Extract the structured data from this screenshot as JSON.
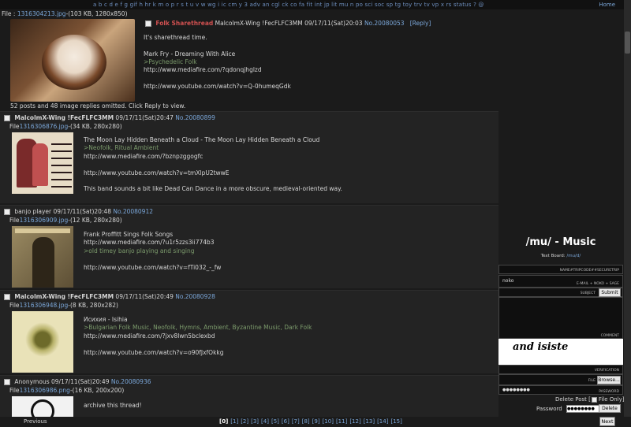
{
  "nav": {
    "boards": "a  b  c  d  e  f  g  gif  h  hr  k  m  o  p  r  s  t  u  v  w  wg  i  ic  cm  y  3  adv  an  cgl  ck  co  fa  fit  int  jp  lit  mu  n  po  sci  soc  sp  tg  toy  trv  tv  vp  x  rs  status  ?  @",
    "home": "Home"
  },
  "op": {
    "file_label": "File : ",
    "file_name": "1316304213.jpg",
    "file_meta": "-(103 KB, 1280x850)",
    "subject": "Folk Sharethread",
    "name": "MalcolmX-Wing !FecFLFC3MM",
    "date": "09/17/11(Sat)20:03",
    "no": "No.20080053",
    "reply_link": "[Reply]",
    "lines": [
      "It's sharethread time.",
      "",
      "Mark Fry - Dreaming With Alice",
      ">Psychedelic Folk",
      "http://www.mediafire.com/?qdonqjhglzd",
      "",
      "http://www.youtube.com/watch?v=Q-0humeqGdk"
    ],
    "omitted": "52 posts and 48 image replies omitted. Click Reply to view."
  },
  "replies": [
    {
      "name": "MalcolmX-Wing !FecFLFC3MM",
      "date": "09/17/11(Sat)20:47",
      "no": "No.20080899",
      "file_name": "1316306876.jpg",
      "file_meta": "-(34 KB, 280x280)",
      "lines": [
        "The Moon Lay Hidden Beneath a Cloud - The Moon Lay Hidden Beneath a Cloud",
        ">Neofolk, Ritual Ambient",
        "http://www.mediafire.com/?bznpzggogfc",
        "",
        "http://www.youtube.com/watch?v=tmXlpU2twwE",
        "",
        "This band sounds a bit like Dead Can Dance in a more obscure, medieval-oriented way."
      ]
    },
    {
      "name": "banjo player",
      "date": "09/17/11(Sat)20:48",
      "no": "No.20080912",
      "file_name": "1316306909.jpg",
      "file_meta": "-(12 KB, 280x280)",
      "lines": [
        "Frank Proffitt Sings Folk Songs",
        "http://www.mediafire.com/?u1r5zzs3ii774b3",
        ">old timey banjo playing and singing",
        "",
        "",
        "http://www.youtube.com/watch?v=fTi032_-_fw"
      ]
    },
    {
      "name": "MalcolmX-Wing !FecFLFC3MM",
      "date": "09/17/11(Sat)20:49",
      "no": "No.20080928",
      "file_name": "1316306948.jpg",
      "file_meta": "-(8 KB, 280x282)",
      "lines": [
        "Исихия - Isihia",
        ">Bulgarian Folk Music, Neofolk, Hymns, Ambient, Byzantine Music, Dark Folk",
        "http://www.mediafire.com/?jxv8lwn5bclexbd",
        "",
        "http://www.youtube.com/watch?v=o90fJxfOkkg"
      ]
    },
    {
      "name": "Anonymous",
      "date": "09/17/11(Sat)20:49",
      "no": "No.20080936",
      "file_name": "1316306986.png",
      "file_meta": "-(16 KB, 200x200)",
      "lines": [
        "archive this thread!"
      ]
    }
  ],
  "sidebar": {
    "board_title": "/mu/ - Music",
    "text_board_label": "Text Board: ",
    "text_board_link": "/mu/d/",
    "name_label": "NAME#TRIPCODE##SECURETRIP",
    "email_value": "noko",
    "email_label": "E-MAIL + NOKO + SAGE",
    "subject_label": "SUBJECT",
    "submit": "Submit",
    "comment_label": "COMMENT",
    "captcha_text": "and  isiste",
    "verification_label": "VERIFICATION",
    "file_label": "FILE",
    "browse": "Browse...",
    "password_label": "PASSWORD",
    "password_value": "●●●●●●●●",
    "delete_post_label": "Delete Post [",
    "file_only_label": "File Only]",
    "password2_label": "Password",
    "delete_button": "Delete"
  },
  "pager": {
    "previous": "Previous",
    "pages": [
      "[0]",
      "[1]",
      "[2]",
      "[3]",
      "[4]",
      "[5]",
      "[6]",
      "[7]",
      "[8]",
      "[9]",
      "[10]",
      "[11]",
      "[12]",
      "[13]",
      "[14]",
      "[15]"
    ],
    "current": "0",
    "next": "Next"
  }
}
